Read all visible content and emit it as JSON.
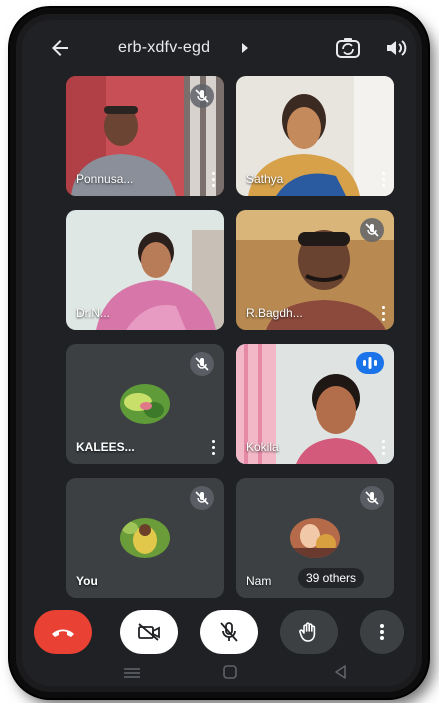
{
  "meeting": {
    "code": "erb-xdfv-egd"
  },
  "participants": [
    {
      "name": "Ponnusa..."
    },
    {
      "name": "Sathya"
    },
    {
      "name": "Dr.N..."
    },
    {
      "name": "R.Bagdh..."
    },
    {
      "name": "KALEES..."
    },
    {
      "name": "Kokila"
    },
    {
      "name": "You"
    },
    {
      "name": "Nam",
      "others_label": "39 others"
    }
  ],
  "colors": {
    "end_call": "#e94235",
    "control_light": "#ffffff",
    "control_dark": "#3c4043",
    "speaking_indicator": "#1a73e8",
    "background": "#202124"
  },
  "icons": {
    "back": "arrow-left-icon",
    "switch_camera": "camera-switch-icon",
    "speaker": "speaker-icon",
    "mic_off": "mic-off-icon",
    "end_call": "hang-up-icon",
    "camera_off": "camera-off-icon",
    "raise_hand": "hand-icon",
    "more": "more-vert-icon"
  }
}
